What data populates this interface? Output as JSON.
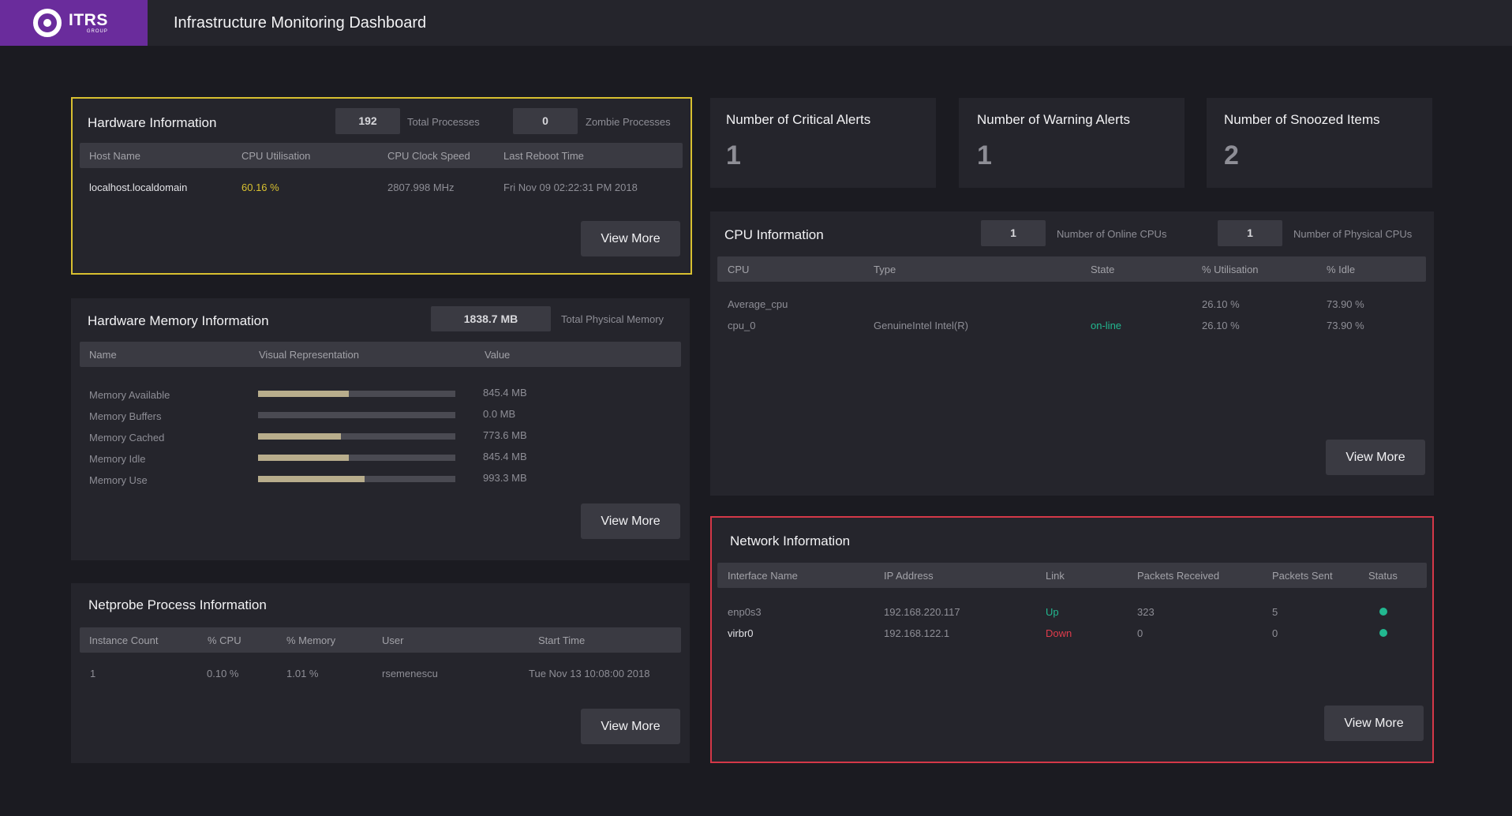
{
  "header": {
    "logo_text": "ITRS",
    "logo_sub": "GROUP",
    "title": "Infrastructure Monitoring Dashboard"
  },
  "hardware": {
    "title": "Hardware Information",
    "total_processes": "192",
    "total_processes_label": "Total Processes",
    "zombie_processes": "0",
    "zombie_processes_label": "Zombie Processes",
    "columns": [
      "Host Name",
      "CPU Utilisation",
      "CPU Clock Speed",
      "Last Reboot Time"
    ],
    "rows": [
      [
        "localhost.localdomain",
        "60.16 %",
        "2807.998 MHz",
        "Fri Nov 09 02:22:31 PM 2018"
      ]
    ],
    "view_more": "View More"
  },
  "memory": {
    "title": "Hardware Memory Information",
    "total": "1838.7 MB",
    "total_label": "Total Physical Memory",
    "columns": [
      "Name",
      "Visual Representation",
      "Value"
    ],
    "rows": [
      {
        "name": "Memory Available",
        "value": "845.4 MB",
        "fraction": 0.46
      },
      {
        "name": "Memory Buffers",
        "value": "0.0 MB",
        "fraction": 0.0
      },
      {
        "name": "Memory Cached",
        "value": "773.6 MB",
        "fraction": 0.42
      },
      {
        "name": "Memory Idle",
        "value": "845.4 MB",
        "fraction": 0.46
      },
      {
        "name": "Memory Use",
        "value": "993.3 MB",
        "fraction": 0.54
      }
    ],
    "view_more": "View More"
  },
  "netprobe": {
    "title": "Netprobe Process Information",
    "columns": [
      "Instance Count",
      "% CPU",
      "% Memory",
      "User",
      "Start Time"
    ],
    "rows": [
      [
        "1",
        "0.10 %",
        "1.01 %",
        "rsemenescu",
        "Tue Nov 13 10:08:00 2018"
      ]
    ],
    "view_more": "View More"
  },
  "alerts": [
    {
      "title": "Number of Critical Alerts",
      "value": "1"
    },
    {
      "title": "Number of Warning Alerts",
      "value": "1"
    },
    {
      "title": "Number of Snoozed Items",
      "value": "2"
    }
  ],
  "cpu": {
    "title": "CPU Information",
    "online_cpus": "1",
    "online_cpus_label": "Number of Online CPUs",
    "physical_cpus": "1",
    "physical_cpus_label": "Number of Physical CPUs",
    "columns": [
      "CPU",
      "Type",
      "State",
      "% Utilisation",
      "% Idle"
    ],
    "rows": [
      [
        "Average_cpu",
        "",
        "",
        "26.10 %",
        "73.90 %"
      ],
      [
        "cpu_0",
        "GenuineIntel Intel(R)",
        "on-line",
        "26.10 %",
        "73.90 %"
      ]
    ],
    "view_more": "View More"
  },
  "network": {
    "title": "Network Information",
    "columns": [
      "Interface Name",
      "IP Address",
      "Link",
      "Packets Received",
      "Packets Sent",
      "Status"
    ],
    "rows": [
      [
        "enp0s3",
        "192.168.220.117",
        "Up",
        "323",
        "5"
      ],
      [
        "virbr0",
        "192.168.122.1",
        "Down",
        "0",
        "0"
      ]
    ],
    "view_more": "View More"
  },
  "colors": {
    "accent_purple": "#6a2c9c",
    "highlight_yellow": "#d8c030",
    "highlight_red": "#d43848",
    "cpu_util_yellow": "#d8c030",
    "status_green": "#22b890",
    "link_up_green": "#22b890",
    "link_down_red": "#e03c4c"
  }
}
